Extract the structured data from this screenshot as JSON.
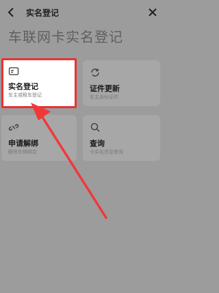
{
  "header": {
    "title": "实名登记"
  },
  "heading": "车联网卡实名登记",
  "cards": [
    {
      "title": "实名登记",
      "subtitle": "车主或租车登记",
      "icon": "id-card-icon"
    },
    {
      "title": "证件更新",
      "subtitle": "车主身份证件",
      "icon": "refresh-icon"
    },
    {
      "title": "申请解绑",
      "subtitle": "解除车辆绑定",
      "icon": "unlink-icon"
    },
    {
      "title": "查询",
      "subtitle": "卡实名信息查询",
      "icon": "search-icon"
    }
  ],
  "colors": {
    "highlight": "#e8322f",
    "arrow": "#f0383a"
  }
}
